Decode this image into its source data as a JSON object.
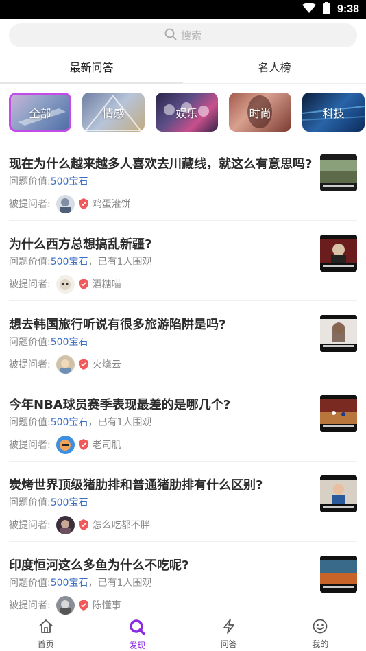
{
  "status_bar": {
    "time": "9:38",
    "icons": [
      "wifi-icon",
      "battery-icon"
    ]
  },
  "search": {
    "placeholder": "搜索"
  },
  "tabs": [
    {
      "label": "最新问答",
      "active": true
    },
    {
      "label": "名人榜",
      "active": false
    }
  ],
  "categories": [
    {
      "label": "全部",
      "active": true
    },
    {
      "label": "情感",
      "active": false
    },
    {
      "label": "娱乐",
      "active": false
    },
    {
      "label": "时尚",
      "active": false
    },
    {
      "label": "科技",
      "active": false
    }
  ],
  "questions": [
    {
      "title": "现在为什么越来越多人喜欢去川藏线，就这么有意思吗?",
      "value_label": "问题价值:",
      "gems": "500宝石",
      "watchers": "",
      "asker_label": "被提问者:",
      "asker": "鸡蛋灌饼"
    },
    {
      "title": "为什么西方总想搞乱新疆?",
      "value_label": "问题价值:",
      "gems": "500宝石",
      "watchers": "，已有1人围观",
      "asker_label": "被提问者:",
      "asker": "酒糖喵"
    },
    {
      "title": "想去韩国旅行听说有很多旅游陷阱是吗?",
      "value_label": "问题价值:",
      "gems": "500宝石",
      "watchers": "",
      "asker_label": "被提问者:",
      "asker": "火烧云"
    },
    {
      "title": "今年NBA球员赛季表现最差的是哪几个?",
      "value_label": "问题价值:",
      "gems": "500宝石",
      "watchers": "，已有1人围观",
      "asker_label": "被提问者:",
      "asker": "老司肌"
    },
    {
      "title": "炭烤世界顶级猪肋排和普通猪肋排有什么区别?",
      "value_label": "问题价值:",
      "gems": "500宝石",
      "watchers": "",
      "asker_label": "被提问者:",
      "asker": "怎么吃都不胖"
    },
    {
      "title": "印度恒河这么多鱼为什么不吃呢?",
      "value_label": "问题价值:",
      "gems": "500宝石",
      "watchers": "，已有1人围观",
      "asker_label": "被提问者:",
      "asker": "陈懂事"
    }
  ],
  "bottom_nav": [
    {
      "label": "首页",
      "icon": "home-icon",
      "active": false
    },
    {
      "label": "发现",
      "icon": "discover-icon",
      "active": true
    },
    {
      "label": "问答",
      "icon": "lightning-icon",
      "active": false
    },
    {
      "label": "我的",
      "icon": "smiley-icon",
      "active": false
    }
  ],
  "colors": {
    "accent": "#8a2be2",
    "gem": "#3b6fc4",
    "active_border": "#c34be7"
  }
}
